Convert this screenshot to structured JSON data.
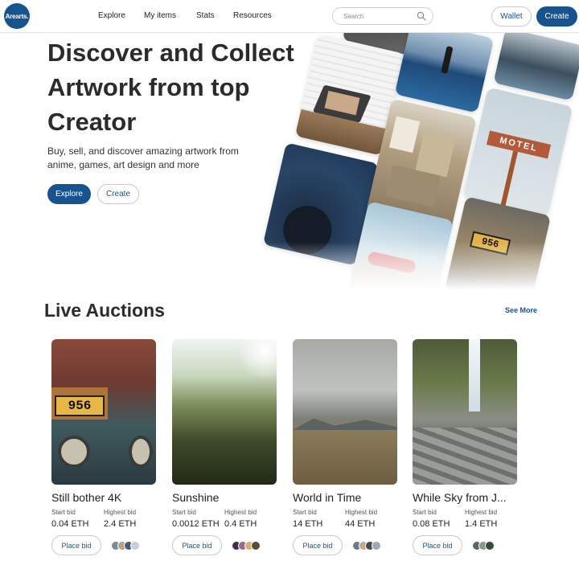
{
  "header": {
    "logo_text": "Arearts.",
    "nav": [
      "Explore",
      "My items",
      "Stats",
      "Resources"
    ],
    "search_placeholder": "Search",
    "wallet_label": "Wallet",
    "create_label": "Create"
  },
  "hero": {
    "title": "Discover and Collect Artwork from top Creator",
    "subtitle": "Buy, sell, and discover amazing artwork from anime, games, art design and more",
    "explore_label": "Explore",
    "create_label": "Create",
    "motel_sign": "MOTEL",
    "plate_text": "956"
  },
  "auctions": {
    "title": "Live Auctions",
    "see_more": "See More",
    "start_label": "Start bid",
    "highest_label": "Highest bid",
    "button_label": "Place bid",
    "items": [
      {
        "title": "Still bother 4K",
        "start": "0.04 ETH",
        "highest": "2.4 ETH",
        "plate": "956"
      },
      {
        "title": "Sunshine",
        "start": "0.0012 ETH",
        "highest": "0.4 ETH"
      },
      {
        "title": "World in Time",
        "start": "14 ETH",
        "highest": "44 ETH"
      },
      {
        "title": "While Sky from J...",
        "start": "0.08 ETH",
        "highest": "1.4 ETH"
      }
    ]
  },
  "colors": {
    "brand": "#17548f",
    "text": "#2b2b2b"
  }
}
